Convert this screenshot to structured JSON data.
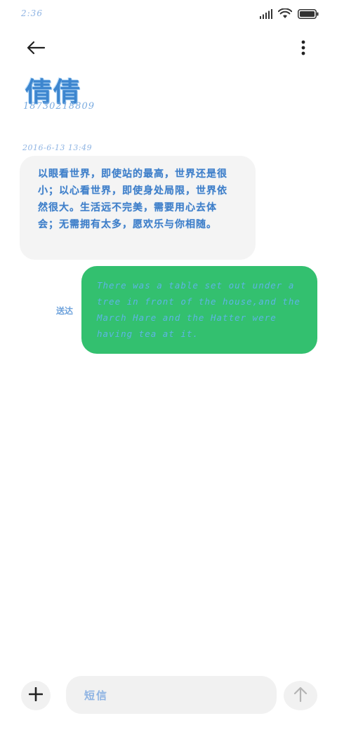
{
  "status_bar": {
    "time": "2:36",
    "icons": [
      "signal-icon",
      "wifi-icon",
      "battery-icon"
    ]
  },
  "top_bar": {
    "back_icon": "arrow-left-icon",
    "more_icon": "more-vertical-icon"
  },
  "contact": {
    "name": "倩倩",
    "number": "18730218809"
  },
  "messages": [
    {
      "direction": "incoming",
      "timestamp": "2016-6-13 13:49",
      "text": "以眼看世界，即使站的最高，世界还是很小；以心看世界，即使身处局限，世界依然很大。生活远不完美，需要用心去体会；无需拥有太多，愿欢乐与你相随。"
    },
    {
      "direction": "outgoing",
      "status": "送达",
      "text": "There was a table set out under a tree in front of the house,and the March Hare and the Hatter were having tea at it."
    }
  ],
  "composer": {
    "add_icon": "plus-icon",
    "placeholder": "短信",
    "send_icon": "arrow-up-icon"
  },
  "colors": {
    "outgoing_bubble": "#33c06f",
    "incoming_bubble": "#f4f4f4",
    "accent_text": "#3f7ec8"
  }
}
